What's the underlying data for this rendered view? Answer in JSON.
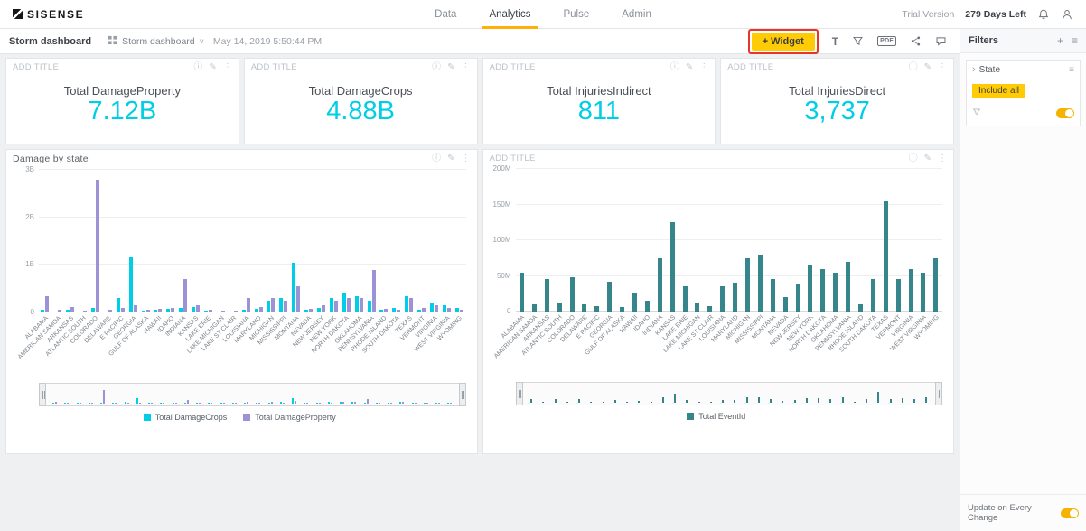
{
  "topbar": {
    "logo_text": "SISENSE",
    "nav": [
      {
        "label": "Data"
      },
      {
        "label": "Analytics"
      },
      {
        "label": "Pulse"
      },
      {
        "label": "Admin"
      }
    ],
    "trial_label": "Trial Version",
    "trial_days": "279 Days Left"
  },
  "toolbar": {
    "dashboard_title": "Storm dashboard",
    "dashboard_selector": "Storm dashboard",
    "timestamp": "May 14, 2019 5:50:44 PM",
    "widget_button_label": "+ Widget",
    "pdf_label": "PDF"
  },
  "filters_panel": {
    "title": "Filters",
    "filter_name": "State",
    "filter_value": "Include all",
    "footer_label": "Update on Every Change"
  },
  "kpis": [
    {
      "header": "ADD TITLE",
      "label": "Total DamageProperty",
      "value": "7.12B"
    },
    {
      "header": "ADD TITLE",
      "label": "Total DamageCrops",
      "value": "4.88B"
    },
    {
      "header": "ADD TITLE",
      "label": "Total InjuriesIndirect",
      "value": "811"
    },
    {
      "header": "ADD TITLE",
      "label": "Total InjuriesDirect",
      "value": "3,737"
    }
  ],
  "chart_data": [
    {
      "type": "bar",
      "title": "Damage by state",
      "categories": [
        "ALABAMA",
        "AMERICAN SAMOA",
        "ARKANSAS",
        "ATLANTIC SOUTH",
        "COLORADO",
        "DELAWARE",
        "E PACIFIC",
        "GEORGIA",
        "GULF OF ALASKA",
        "HAWAII",
        "IDAHO",
        "INDIANA",
        "KANSAS",
        "LAKE ERIE",
        "LAKE MICHIGAN",
        "LAKE ST CLAIR",
        "LOUISIANA",
        "MARYLAND",
        "MICHIGAN",
        "MISSISSIPPI",
        "MONTANA",
        "NEVADA",
        "NEW JERSEY",
        "NEW YORK",
        "NORTH DAKOTA",
        "OKLAHOMA",
        "PENNSYLVANIA",
        "RHODE ISLAND",
        "SOUTH DAKOTA",
        "TEXAS",
        "VERMONT",
        "VIRGINIA",
        "WEST VIRGINIA",
        "WYOMING"
      ],
      "series": [
        {
          "name": "Total DamageCrops",
          "color": "#00cee6",
          "values": [
            0.05,
            0.02,
            0.05,
            0.02,
            0.1,
            0.02,
            0.3,
            1.15,
            0.03,
            0.05,
            0.08,
            0.1,
            0.12,
            0.03,
            0.02,
            0.02,
            0.05,
            0.08,
            0.25,
            0.3,
            1.05,
            0.05,
            0.1,
            0.3,
            0.4,
            0.35,
            0.25,
            0.05,
            0.1,
            0.35,
            0.05,
            0.2,
            0.15,
            0.1
          ]
        },
        {
          "name": "Total DamageProperty",
          "color": "#9b93d6",
          "values": [
            0.35,
            0.05,
            0.12,
            0.03,
            2.8,
            0.05,
            0.1,
            0.15,
            0.05,
            0.08,
            0.1,
            0.7,
            0.15,
            0.05,
            0.04,
            0.03,
            0.3,
            0.12,
            0.3,
            0.25,
            0.55,
            0.08,
            0.15,
            0.25,
            0.3,
            0.3,
            0.9,
            0.08,
            0.05,
            0.3,
            0.1,
            0.15,
            0.1,
            0.05
          ]
        }
      ],
      "ylim": [
        0,
        3
      ],
      "unit": "B",
      "yticks": [
        "3B",
        "2B",
        "1B",
        "0"
      ],
      "grid": true,
      "legend_position": "bottom"
    },
    {
      "type": "bar",
      "title": "ADD TITLE",
      "categories": [
        "ALABAMA",
        "AMERICAN SAMOA",
        "ARKANSAS",
        "ATLANTIC SOUTH",
        "COLORADO",
        "DELAWARE",
        "E PACIFIC",
        "GEORGIA",
        "GULF OF ALASKA",
        "HAWAII",
        "IDAHO",
        "INDIANA",
        "KANSAS",
        "LAKE ERIE",
        "LAKE MICHIGAN",
        "LAKE ST CLAIR",
        "LOUISIANA",
        "MARYLAND",
        "MICHIGAN",
        "MISSISSIPPI",
        "MONTANA",
        "NEVADA",
        "NEW JERSEY",
        "NEW YORK",
        "NORTH DAKOTA",
        "OKLAHOMA",
        "PENNSYLVANIA",
        "RHODE ISLAND",
        "SOUTH DAKOTA",
        "TEXAS",
        "VERMONT",
        "VIRGINIA",
        "WEST VIRGINIA",
        "WYOMING"
      ],
      "series": [
        {
          "name": "Total EventId",
          "color": "#35858b",
          "values": [
            55,
            10,
            45,
            12,
            48,
            10,
            8,
            42,
            6,
            25,
            15,
            75,
            125,
            35,
            12,
            8,
            35,
            40,
            75,
            80,
            45,
            20,
            38,
            65,
            60,
            55,
            70,
            10,
            45,
            155,
            45,
            60,
            55,
            75
          ]
        }
      ],
      "ylim": [
        0,
        200
      ],
      "unit": "M",
      "yticks": [
        "200M",
        "150M",
        "100M",
        "50M",
        "0"
      ],
      "grid": true,
      "legend_position": "bottom"
    }
  ],
  "icons": {
    "info": "ⓘ",
    "edit": "✎",
    "more": "⋮",
    "plus": "+",
    "menu": "≡",
    "chevron_right": "›",
    "caret_down": "˅",
    "text_widget": "T"
  },
  "colors": {
    "accent_yellow": "#ffcb05",
    "highlight_red": "#e8352a",
    "active_tab_orange": "#ffb10a",
    "kpi_value_cyan": "#00cee6",
    "bar_cyan": "#00cee6",
    "bar_purple": "#9b93d6",
    "bar_teal": "#35858b"
  }
}
